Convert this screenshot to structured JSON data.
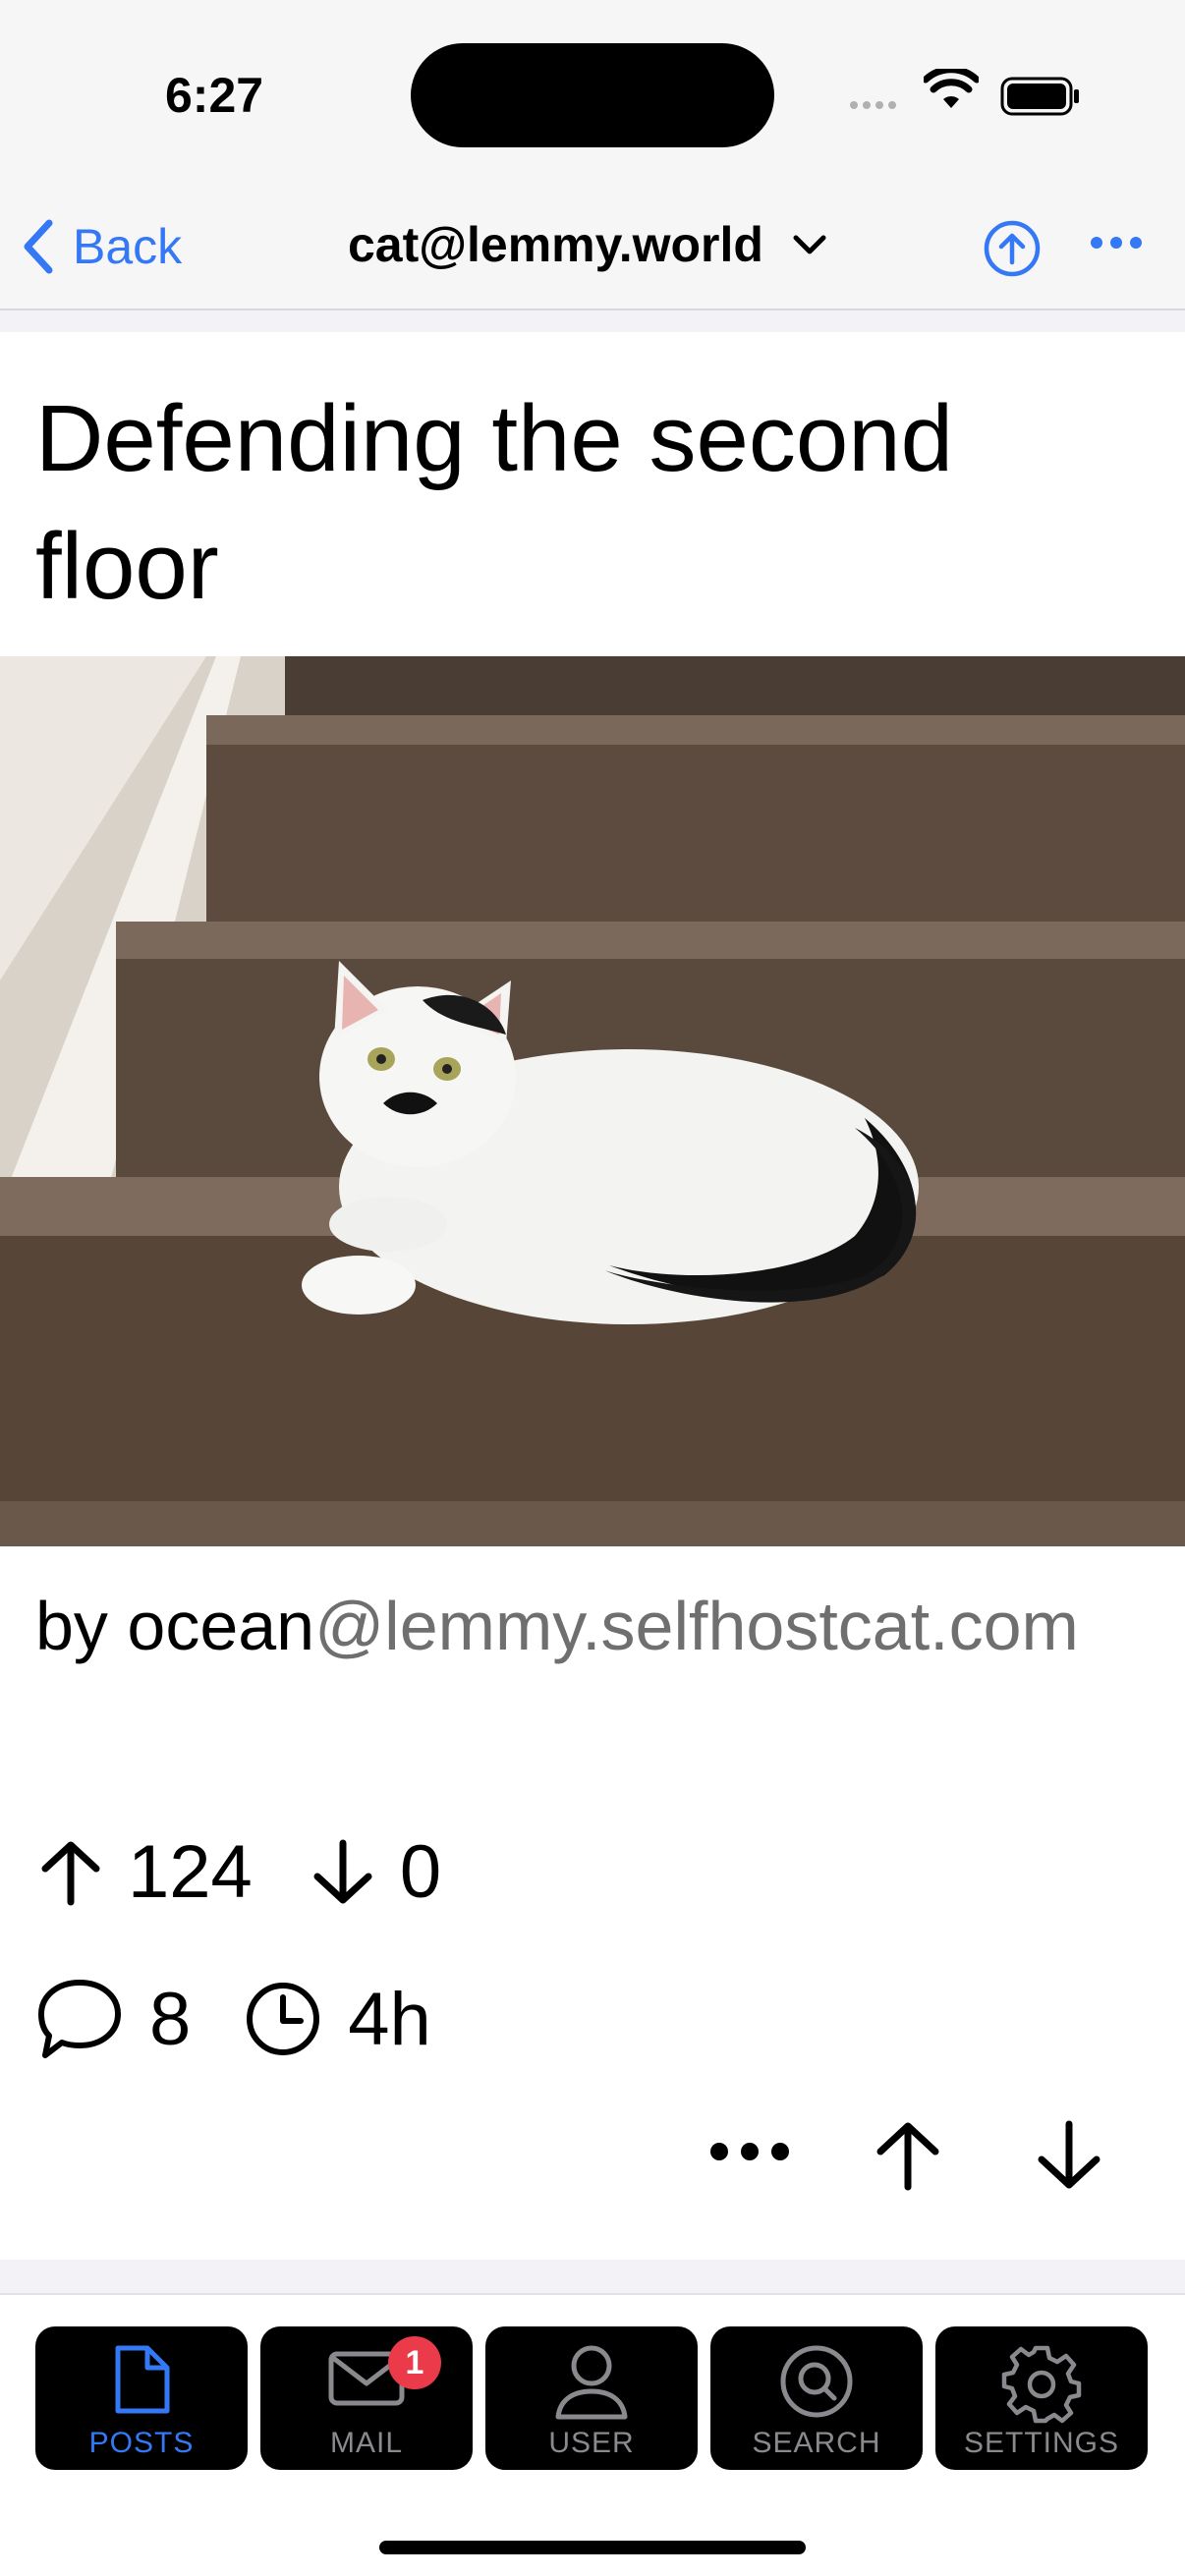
{
  "status_bar": {
    "time": "6:27"
  },
  "nav": {
    "back_label": "Back",
    "community": "cat@lemmy.world"
  },
  "post": {
    "title": "Defending the second floor",
    "author_prefix": "by ",
    "author_user": "ocean",
    "author_instance": "@lemmy.selfhostcat.com",
    "upvotes": "124",
    "downvotes": "0",
    "comments": "8",
    "age": "4h",
    "image_alt": "White cat with black mustache-like marking and black tail lying on carpeted stairs"
  },
  "tabs": [
    {
      "label": "POSTS",
      "icon": "document-icon",
      "active": true
    },
    {
      "label": "MAIL",
      "icon": "mail-icon",
      "badge": "1"
    },
    {
      "label": "USER",
      "icon": "user-icon"
    },
    {
      "label": "SEARCH",
      "icon": "search-icon"
    },
    {
      "label": "SETTINGS",
      "icon": "gear-icon"
    }
  ],
  "colors": {
    "accent": "#3478f6",
    "badge": "#eb3b4b",
    "tab_bg": "#000000"
  }
}
